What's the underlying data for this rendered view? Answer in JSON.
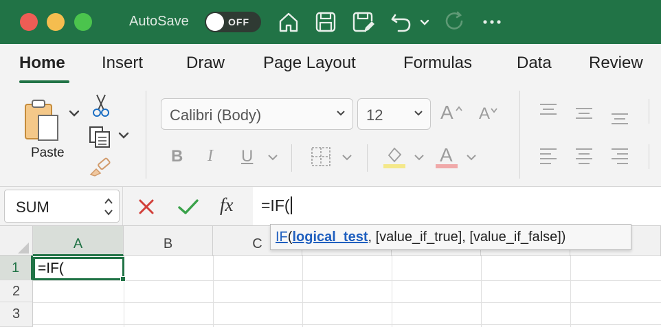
{
  "titlebar": {
    "autosave_label": "AutoSave",
    "autosave_state": "OFF",
    "icons": [
      "home-icon",
      "save-icon",
      "save-edit-icon",
      "undo-icon",
      "redo-icon",
      "more-icon"
    ]
  },
  "ribbon": {
    "tabs": [
      {
        "label": "Home",
        "active": true
      },
      {
        "label": "Insert"
      },
      {
        "label": "Draw"
      },
      {
        "label": "Page Layout"
      },
      {
        "label": "Formulas"
      },
      {
        "label": "Data"
      },
      {
        "label": "Review"
      }
    ],
    "paste_label": "Paste",
    "font_name": "Calibri (Body)",
    "font_size": "12",
    "grow_font": "A",
    "shrink_font": "A",
    "bold": "B",
    "italic": "I",
    "underline": "U",
    "font_color_letter": "A"
  },
  "formula_bar": {
    "name_box": "SUM",
    "fx": "fx",
    "formula": "=IF("
  },
  "tooltip": {
    "func": "IF",
    "open": "(",
    "arg1": "logical_test",
    "rest": ", [value_if_true], [value_if_false])"
  },
  "sheet": {
    "columns": [
      "A",
      "B",
      "C"
    ],
    "rows": [
      "1",
      "2",
      "3"
    ],
    "active_cell_value": "=IF("
  },
  "colors": {
    "accent": "#217346",
    "link": "#1f5fbf"
  }
}
